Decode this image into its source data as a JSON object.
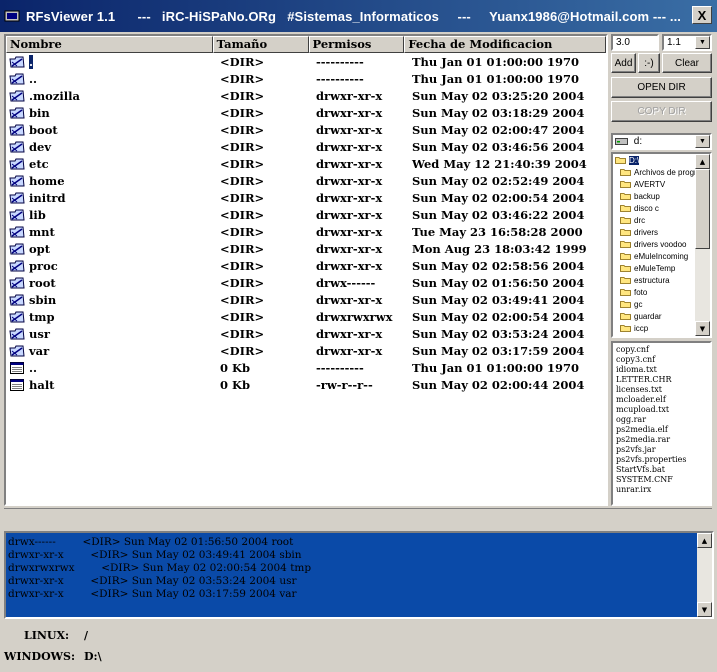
{
  "window": {
    "title": "RFsViewer 1.1      ---   iRC-HiSPaNo.ORg   #Sistemas_Informaticos     ---     Yuanx1986@Hotmail.com --- ...",
    "close_label": "X"
  },
  "table": {
    "columns": [
      "Nombre",
      "Tamaño",
      "Permisos",
      "Fecha de Modificacion"
    ],
    "rows": [
      {
        "name": ".",
        "size": "<DIR>",
        "perm": "----------",
        "date": "Thu Jan 01 01:00:00 1970",
        "icon": "folder-link-icon",
        "selected": true
      },
      {
        "name": "..",
        "size": "<DIR>",
        "perm": "----------",
        "date": "Thu Jan 01 01:00:00 1970",
        "icon": "folder-link-icon"
      },
      {
        "name": ".mozilla",
        "size": "<DIR>",
        "perm": "drwxr-xr-x",
        "date": "Sun May 02 03:25:20 2004",
        "icon": "folder-link-icon"
      },
      {
        "name": "bin",
        "size": "<DIR>",
        "perm": "drwxr-xr-x",
        "date": "Sun May 02 03:18:29 2004",
        "icon": "folder-link-icon"
      },
      {
        "name": "boot",
        "size": "<DIR>",
        "perm": "drwxr-xr-x",
        "date": "Sun May 02 02:00:47 2004",
        "icon": "folder-link-icon"
      },
      {
        "name": "dev",
        "size": "<DIR>",
        "perm": "drwxr-xr-x",
        "date": "Sun May 02 03:46:56 2004",
        "icon": "folder-link-icon"
      },
      {
        "name": "etc",
        "size": "<DIR>",
        "perm": "drwxr-xr-x",
        "date": "Wed May 12 21:40:39 2004",
        "icon": "folder-link-icon"
      },
      {
        "name": "home",
        "size": "<DIR>",
        "perm": "drwxr-xr-x",
        "date": "Sun May 02 02:52:49 2004",
        "icon": "folder-link-icon"
      },
      {
        "name": "initrd",
        "size": "<DIR>",
        "perm": "drwxr-xr-x",
        "date": "Sun May 02 02:00:54 2004",
        "icon": "folder-link-icon"
      },
      {
        "name": "lib",
        "size": "<DIR>",
        "perm": "drwxr-xr-x",
        "date": "Sun May 02 03:46:22 2004",
        "icon": "folder-link-icon"
      },
      {
        "name": "mnt",
        "size": "<DIR>",
        "perm": "drwxr-xr-x",
        "date": "Tue May 23 16:58:28 2000",
        "icon": "folder-link-icon"
      },
      {
        "name": "opt",
        "size": "<DIR>",
        "perm": "drwxr-xr-x",
        "date": "Mon Aug 23 18:03:42 1999",
        "icon": "folder-link-icon"
      },
      {
        "name": "proc",
        "size": "<DIR>",
        "perm": "drwxr-xr-x",
        "date": "Sun May 02 02:58:56 2004",
        "icon": "folder-link-icon"
      },
      {
        "name": "root",
        "size": "<DIR>",
        "perm": "drwx------",
        "date": "Sun May 02 01:56:50 2004",
        "icon": "folder-link-icon"
      },
      {
        "name": "sbin",
        "size": "<DIR>",
        "perm": "drwxr-xr-x",
        "date": "Sun May 02 03:49:41 2004",
        "icon": "folder-link-icon"
      },
      {
        "name": "tmp",
        "size": "<DIR>",
        "perm": "drwxrwxrwx",
        "date": "Sun May 02 02:00:54 2004",
        "icon": "folder-link-icon"
      },
      {
        "name": "usr",
        "size": "<DIR>",
        "perm": "drwxr-xr-x",
        "date": "Sun May 02 03:53:24 2004",
        "icon": "folder-link-icon"
      },
      {
        "name": "var",
        "size": "<DIR>",
        "perm": "drwxr-xr-x",
        "date": "Sun May 02 03:17:59 2004",
        "icon": "folder-link-icon"
      },
      {
        "name": "..",
        "size": "0 Kb",
        "perm": "----------",
        "date": "Thu Jan 01 01:00:00 1970",
        "icon": "file-icon"
      },
      {
        "name": "halt",
        "size": "0 Kb",
        "perm": "-rw-r--r--",
        "date": "Sun May 02 02:00:44 2004",
        "icon": "file-icon"
      }
    ]
  },
  "right": {
    "input_value": "3.0",
    "version_combo": "1.1",
    "add_label": "Add",
    "smiley_label": ":-)",
    "clear_label": "Clear",
    "open_dir_label": "OPEN DIR",
    "copy_dir_label": "COPY DIR",
    "drive_value": "d:",
    "dirs": [
      "D:\\",
      "Archivos de programa",
      "AVERTV",
      "backup",
      "disco c",
      "drc",
      "drivers",
      "drivers voodoo",
      "eMuleIncoming",
      "eMuleTemp",
      "estructura",
      "foto",
      "gc",
      "guardar",
      "iccp"
    ],
    "files": [
      "copy.cnf",
      "copy3.cnf",
      "idioma.txt",
      "LETTER.CHR",
      "licenses.txt",
      "mcloader.elf",
      "mcupload.txt",
      "ogg.rar",
      "ps2media.elf",
      "ps2media.rar",
      "ps2vfs.jar",
      "ps2vfs.properties",
      "StartVfs.bat",
      "SYSTEM.CNF",
      "unrar.irx"
    ]
  },
  "log": [
    "drwx------        <DIR> Sun May 02 01:56:50 2004 root",
    "drwxr-xr-x        <DIR> Sun May 02 03:49:41 2004 sbin",
    "drwxrwxrwx        <DIR> Sun May 02 02:00:54 2004 tmp",
    "drwxr-xr-x        <DIR> Sun May 02 03:53:24 2004 usr",
    "drwxr-xr-x        <DIR> Sun May 02 03:17:59 2004 var"
  ],
  "status": {
    "linux_label": "LINUX:",
    "linux_value": "/",
    "windows_label": "WINDOWS:",
    "windows_value": "D:\\"
  }
}
